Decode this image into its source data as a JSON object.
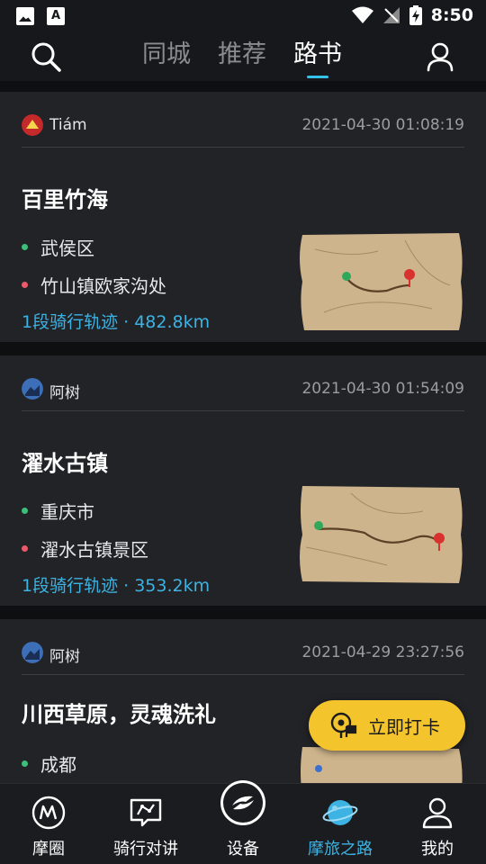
{
  "status_bar": {
    "time": "8:50"
  },
  "top_nav": {
    "tabs": [
      {
        "label": "同城",
        "active": false
      },
      {
        "label": "推荐",
        "active": false
      },
      {
        "label": "路书",
        "active": true
      }
    ],
    "accent": "#34c1ea"
  },
  "feed": [
    {
      "author": "Tiám",
      "timestamp": "2021-04-30 01:08:19",
      "title": "百里竹海",
      "start": "武侯区",
      "end": "竹山镇欧家沟处",
      "track": "1段骑行轨迹 · 482.8km"
    },
    {
      "author": "阿树",
      "timestamp": "2021-04-30 01:54:09",
      "title": "濯水古镇",
      "start": "重庆市",
      "end": "濯水古镇景区",
      "track": "1段骑行轨迹 · 353.2km"
    },
    {
      "author": "阿树",
      "timestamp": "2021-04-29 23:27:56",
      "title": "川西草原，灵魂洗礼",
      "start": "成都"
    }
  ],
  "checkin_button": {
    "label": "立即打卡"
  },
  "bottom_nav": {
    "items": [
      {
        "label": "摩圈",
        "icon": "m-circle-icon"
      },
      {
        "label": "骑行对讲",
        "icon": "intercom-icon"
      },
      {
        "label": "设备",
        "icon": "device-icon"
      },
      {
        "label": "摩旅之路",
        "icon": "planet-icon",
        "active": true
      },
      {
        "label": "我的",
        "icon": "profile-icon"
      }
    ]
  },
  "colors": {
    "start_dot": "#3bbf7a",
    "end_dot": "#ec5a6a",
    "track_text": "#3cb3e3",
    "checkin_bg": "#f3c42b"
  }
}
